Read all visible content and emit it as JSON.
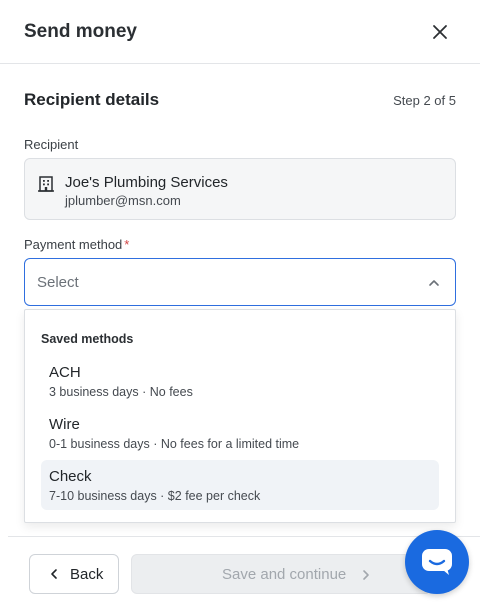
{
  "header": {
    "title": "Send money"
  },
  "section": {
    "title": "Recipient details",
    "step": "Step 2 of 5"
  },
  "recipient": {
    "label": "Recipient",
    "name": "Joe's Plumbing Services",
    "email": "jplumber@msn.com"
  },
  "payment_method": {
    "label": "Payment method",
    "required_mark": "*",
    "placeholder": "Select",
    "dropdown": {
      "group_label": "Saved methods",
      "options": [
        {
          "title": "ACH",
          "description": "3 business days · No fees"
        },
        {
          "title": "Wire",
          "description": "0-1 business days · No fees for a limited time"
        },
        {
          "title": "Check",
          "description": "7-10 business days · $2 fee per check"
        }
      ]
    }
  },
  "footer": {
    "back_label": "Back",
    "continue_label": "Save and continue"
  },
  "colors": {
    "accent": "#2f6fdf",
    "chat_button": "#1a6ae0",
    "required": "#d14343"
  },
  "icons": [
    "close-icon",
    "building-icon",
    "chevron-up-icon",
    "chevron-left-icon",
    "chevron-right-icon",
    "chat-icon"
  ]
}
